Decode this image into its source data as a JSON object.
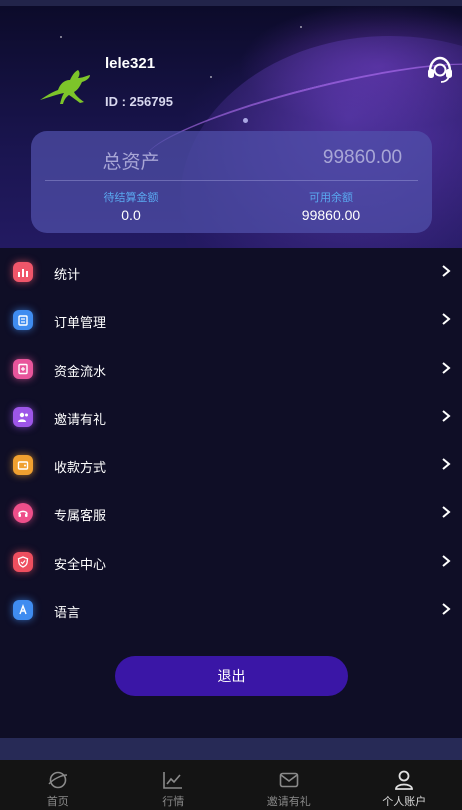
{
  "header": {
    "username": "lele321",
    "user_id": "ID : 256795"
  },
  "assets": {
    "title": "总资产",
    "total": "99860.00",
    "pending_label": "待结算金额",
    "pending_value": "0.0",
    "available_label": "可用余额",
    "available_value": "99860.00"
  },
  "menu": {
    "items": [
      {
        "label": "统计",
        "icon": "chart-icon",
        "color": "#f0566a"
      },
      {
        "label": "订单管理",
        "icon": "order-icon",
        "color": "#3f8cf0"
      },
      {
        "label": "资金流水",
        "icon": "ledger-icon",
        "color": "#e8559b"
      },
      {
        "label": "邀请有礼",
        "icon": "invite-icon",
        "color": "#9d56e8"
      },
      {
        "label": "收款方式",
        "icon": "wallet-icon",
        "color": "#f0a030"
      },
      {
        "label": "专属客服",
        "icon": "headset-icon",
        "color": "#ee4f8a"
      },
      {
        "label": "安全中心",
        "icon": "shield-icon",
        "color": "#ee4f5f"
      },
      {
        "label": "语言",
        "icon": "language-icon",
        "color": "#3f8cf0"
      }
    ]
  },
  "logout_label": "退出",
  "tabs": [
    {
      "label": "首页",
      "icon": "planet-icon"
    },
    {
      "label": "行情",
      "icon": "market-chart-icon"
    },
    {
      "label": "邀请有礼",
      "icon": "mail-icon"
    },
    {
      "label": "个人账户",
      "icon": "user-icon",
      "active": true
    }
  ],
  "colors": {
    "accent": "#3a16a6",
    "background": "#0f0e26",
    "card": "#4f4fa8",
    "sub_label": "#5aa8f0"
  }
}
